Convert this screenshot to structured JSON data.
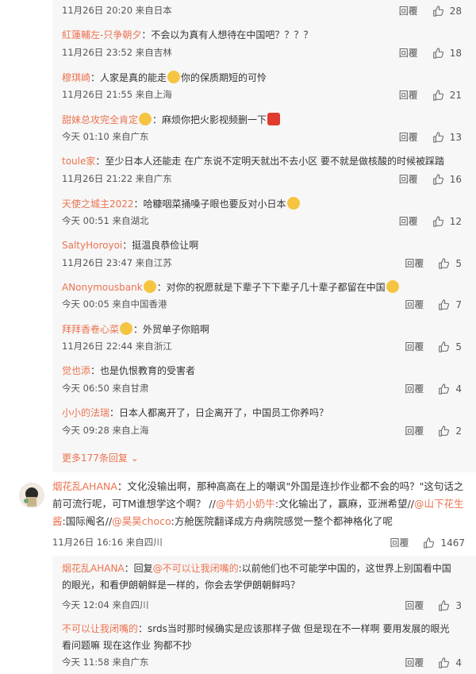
{
  "replies": [
    {
      "user": "",
      "text": "",
      "meta": "11月26日 20:20 来自日本",
      "reply_label": "回覆",
      "likes": "28"
    },
    {
      "user": "紅蓮輔左-只争朝夕",
      "text": "：不会以为真有人想待在中国吧？？？？",
      "meta": "11月26日 23:52 来自吉林",
      "reply_label": "回覆",
      "likes": "18"
    },
    {
      "user": "穆琪崎",
      "text": "：人家是真的能走",
      "text2": "你的保质期短的可怜",
      "meta": "11月26日 21:55 来自上海",
      "reply_label": "回覆",
      "likes": "21"
    },
    {
      "user": "甜妹总攻完全肯定",
      "text": "：麻烦你把火影视频删一下",
      "meta": "今天 01:10 来自广东",
      "reply_label": "回覆",
      "likes": "13"
    },
    {
      "user": "toule家",
      "text": "：至少日本人还能走 在广东说不定明天就出不去小区 要不就是做核酸的时候被踩踏",
      "meta": "11月26日 21:22 来自广东",
      "reply_label": "回覆",
      "likes": "16"
    },
    {
      "user": "天使之城主2022",
      "text": "：哈糠咽菜捅嗓子眼也要反对小日本",
      "meta": "今天 00:51 来自湖北",
      "reply_label": "回覆",
      "likes": "12"
    },
    {
      "user": "SaltyHoroyoi",
      "text": "：挺温良恭俭让啊",
      "meta": "11月26日 23:47 来自江苏",
      "reply_label": "回覆",
      "likes": "5"
    },
    {
      "user": "ANonymousbank",
      "text": "：对你的祝愿就是下辈子下下辈子几十辈子都留在中国",
      "meta": "今天 00:05 来自中国香港",
      "reply_label": "回覆",
      "likes": "7"
    },
    {
      "user": "拜拜香卷心菜",
      "text": "：外贸单子你赔啊",
      "meta": "11月26日 22:44 来自浙江",
      "reply_label": "回覆",
      "likes": "5"
    },
    {
      "user": "觉也添",
      "text": "：也是仇恨教育的受害者",
      "meta": "今天 06:50 来自甘肃",
      "reply_label": "回覆",
      "likes": "4"
    },
    {
      "user": "小小的法瑞",
      "text": "：日本人都离开了，日企离开了，中国员工你养吗？",
      "meta": "今天 09:28 来自上海",
      "reply_label": "回覆",
      "likes": "2"
    }
  ],
  "more_replies": "更多177条回复",
  "main_comment": {
    "user": "烟花乱AHANA",
    "text1": "：文化没输出啊，那种高高在上的嘲讽\"外国是连抄作业都不会的吗？\"这句话之前可流行呢，可TM谁想学这个啊？ //",
    "mention1": "@牛奶小奶牛",
    "text2": ":文化输出了，赢麻，亚洲希望//",
    "mention2": "@山下花生酱",
    "text3": ":国际阄名//",
    "mention3": "@昊昊choco",
    "text4": ":方舱医院翻译成方舟病院感觉一整个都神格化了呢",
    "meta": "11月26日 16:16 来自四川",
    "reply_label": "回覆",
    "likes": "1467"
  },
  "sub_replies": [
    {
      "user": "烟花乱AHANA",
      "text": "：回复",
      "mention": "@不可以让我闭嘴的",
      "text2": ":以前他们也不可能学中国的，这世界上别国看中国的眼光，和看伊朗朝鲜是一样的，你会去学伊朗朝鲜吗？",
      "meta": "今天 12:04 来自四川",
      "reply_label": "回覆",
      "likes": "3"
    },
    {
      "user": "不可以让我闭嘴的",
      "text": "：srds当时那时候确实是应该那样子做 但是现在不一样啊 要用发展的眼光看问题嘛 现在这作业 狗都不抄",
      "meta": "今天 11:58 来自广东",
      "reply_label": "回覆",
      "likes": "4"
    }
  ]
}
